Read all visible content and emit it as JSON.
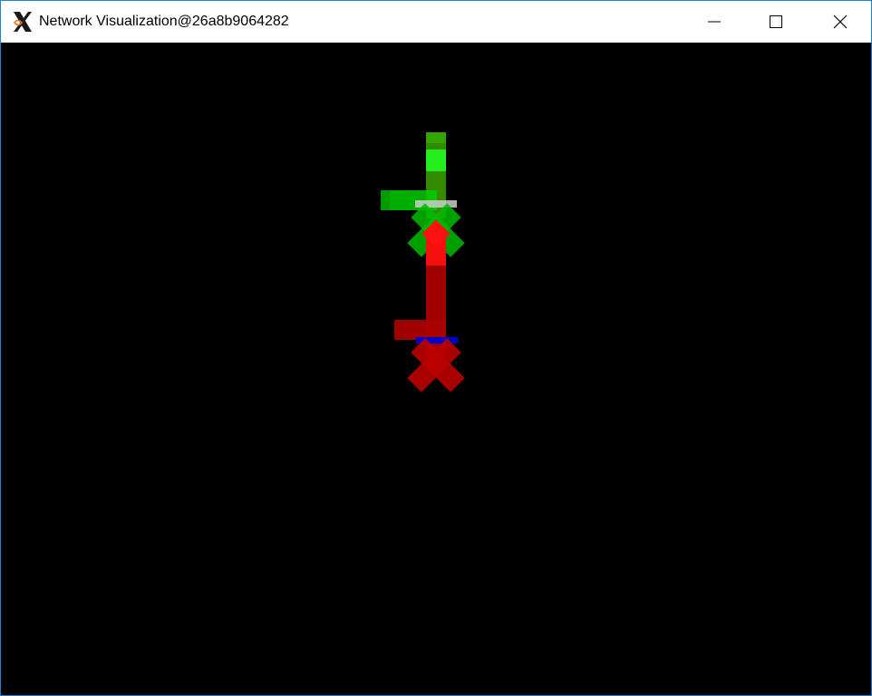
{
  "window": {
    "title": "Network Visualization@26a8b9064282",
    "controls": {
      "minimize": "minimize",
      "maximize": "maximize",
      "close": "close"
    }
  },
  "canvas": {
    "background": "#000000",
    "figures": [
      {
        "name": "upper-figure",
        "primary_color": "#00cc00",
        "highlight_color": "#22ff22",
        "shade_color": "#4a9a00",
        "marker_color": "#cccccc"
      },
      {
        "name": "lower-figure",
        "primary_color": "#cc0000",
        "highlight_color": "#ff1111",
        "shade_color": "#990000",
        "marker_color": "#0000cc"
      }
    ]
  }
}
